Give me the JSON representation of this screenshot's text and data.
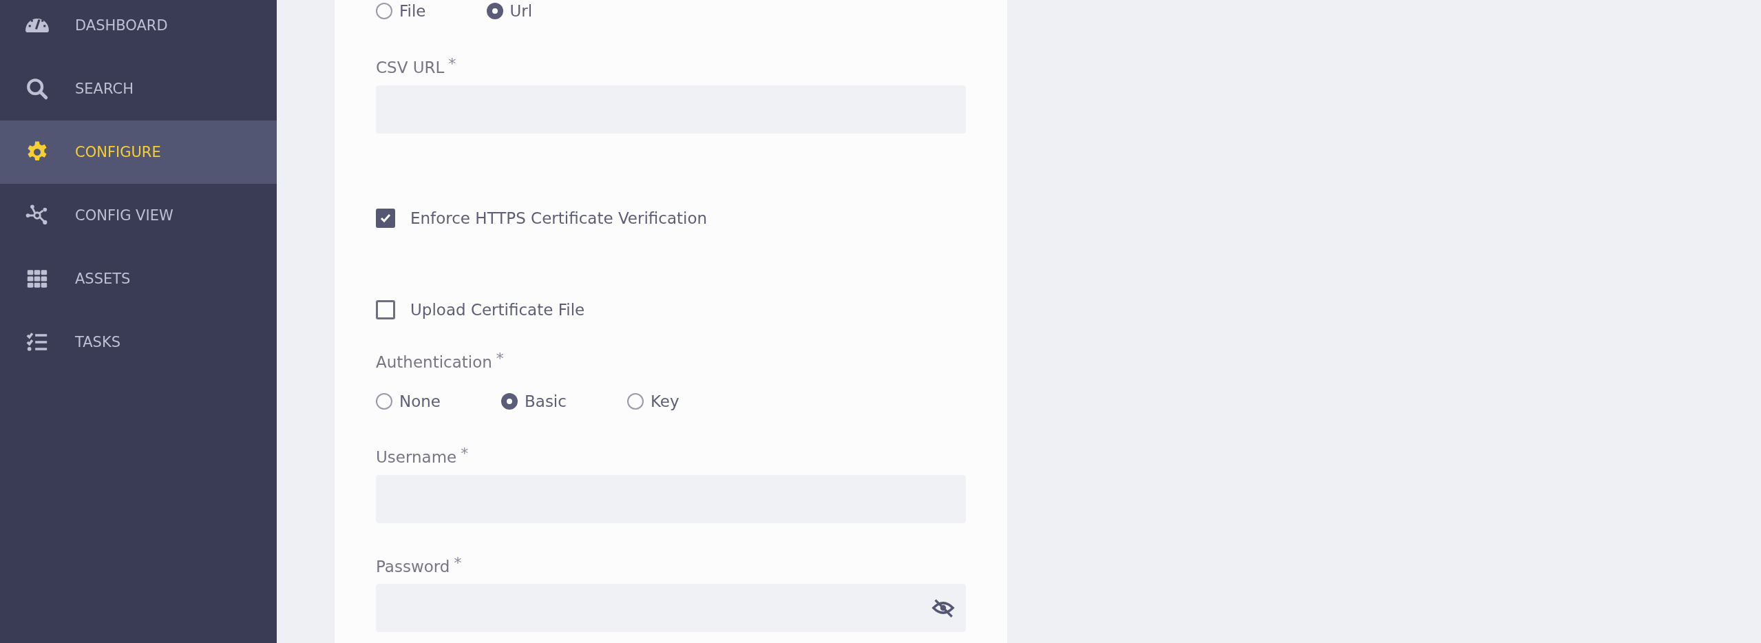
{
  "sidebar": {
    "items": [
      {
        "label": "DASHBOARD",
        "selected": false
      },
      {
        "label": "SEARCH",
        "selected": false
      },
      {
        "label": "CONFIGURE",
        "selected": true
      },
      {
        "label": "CONFIG VIEW",
        "selected": false
      },
      {
        "label": "ASSETS",
        "selected": false
      },
      {
        "label": "TASKS",
        "selected": false
      }
    ]
  },
  "form": {
    "source_options": [
      {
        "label": "File",
        "selected": false
      },
      {
        "label": "Url",
        "selected": true
      }
    ],
    "csv_url": {
      "label": "CSV URL",
      "required_mark": "*"
    },
    "checkboxes": [
      {
        "label": "Enforce HTTPS Certificate Verification",
        "checked": true
      },
      {
        "label": "Upload Certificate File",
        "checked": false
      }
    ],
    "authentication": {
      "label": "Authentication",
      "required_mark": "*",
      "options": [
        {
          "label": "None",
          "selected": false
        },
        {
          "label": "Basic",
          "selected": true
        },
        {
          "label": "Key",
          "selected": false
        }
      ]
    },
    "username": {
      "label": "Username",
      "required_mark": "*"
    },
    "password": {
      "label": "Password",
      "required_mark": "*"
    }
  }
}
